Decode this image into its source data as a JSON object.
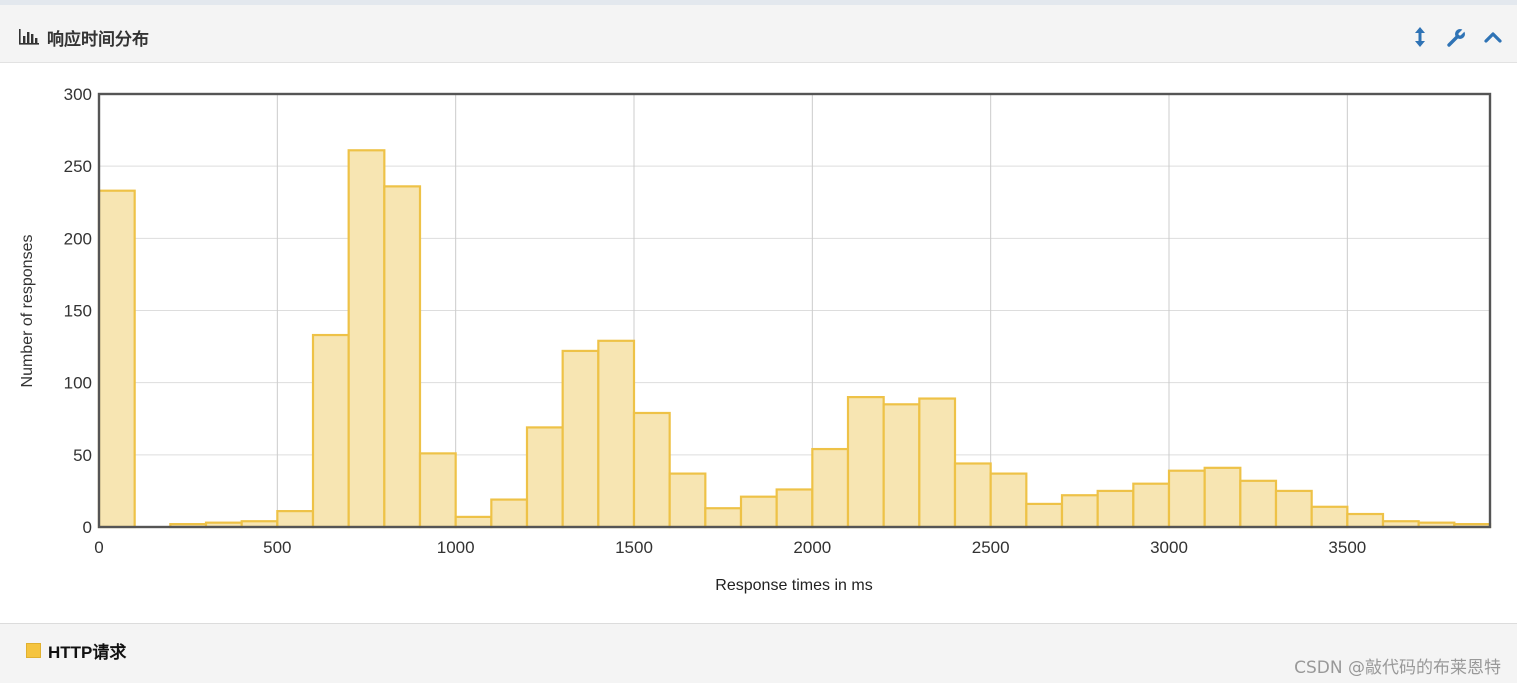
{
  "panel": {
    "title": "响应时间分布",
    "icons": [
      "bar-chart-icon",
      "resize-vertical-icon",
      "wrench-icon",
      "chevron-up-icon"
    ]
  },
  "legend": {
    "label": "HTTP请求"
  },
  "watermark": "CSDN @敲代码的布莱恩特",
  "colors": {
    "bar_fill": "#f7e5b2",
    "bar_stroke": "#eec247",
    "icon": "#2f73b5",
    "legend": "#f5c43f"
  },
  "chart_data": {
    "type": "bar",
    "title": "",
    "xlabel": "Response times in ms",
    "ylabel": "Number of responses",
    "xlim": [
      0,
      3900
    ],
    "ylim": [
      0,
      300
    ],
    "xticks": [
      0,
      500,
      1000,
      1500,
      2000,
      2500,
      3000,
      3500
    ],
    "yticks": [
      0,
      50,
      100,
      150,
      200,
      250,
      300
    ],
    "bin_width": 100,
    "grid": true,
    "series": [
      {
        "name": "HTTP请求",
        "bins": [
          0,
          100,
          200,
          300,
          400,
          500,
          600,
          700,
          800,
          900,
          1000,
          1100,
          1200,
          1300,
          1400,
          1500,
          1600,
          1700,
          1800,
          1900,
          2000,
          2100,
          2200,
          2300,
          2400,
          2500,
          2600,
          2700,
          2800,
          2900,
          3000,
          3100,
          3200,
          3300,
          3400,
          3500,
          3600,
          3700,
          3800
        ],
        "values": [
          233,
          0,
          2,
          3,
          4,
          11,
          133,
          261,
          236,
          51,
          7,
          19,
          69,
          122,
          129,
          79,
          37,
          13,
          21,
          26,
          54,
          90,
          85,
          89,
          44,
          37,
          16,
          22,
          25,
          30,
          39,
          41,
          32,
          25,
          14,
          9,
          4,
          3,
          2
        ]
      }
    ]
  }
}
